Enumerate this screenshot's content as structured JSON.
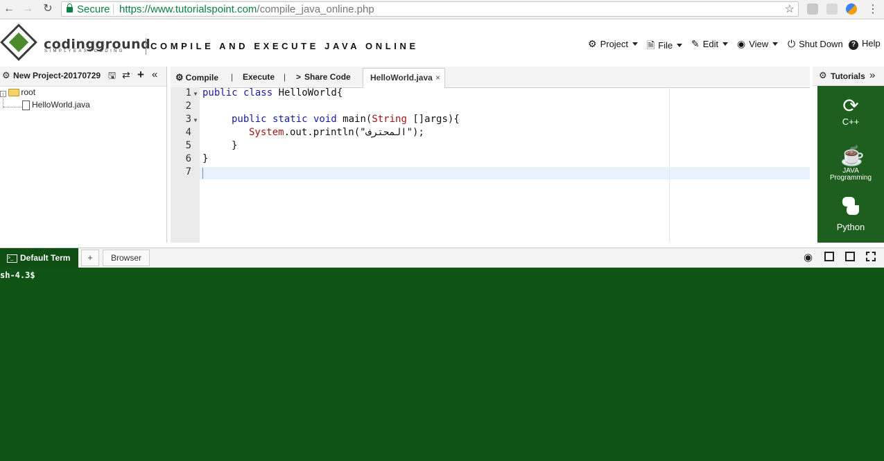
{
  "browser": {
    "secure_label": "Secure",
    "url_host": "https://www.tutorialspoint.com",
    "url_path": "/compile_java_online.php"
  },
  "header": {
    "logo_name": "codingground",
    "logo_sub": "SIMPLYEASYCODING",
    "tagline": "COMPILE AND EXECUTE JAVA ONLINE",
    "menus": [
      "Project",
      "File",
      "Edit",
      "View",
      "Shut Down",
      "Help"
    ]
  },
  "project": {
    "title": "New Project-20170729",
    "tree_root": "root",
    "tree_file": "HelloWorld.java"
  },
  "editor": {
    "compile_label": "Compile",
    "execute_label": "Execute",
    "share_label": "Share Code",
    "separator": "|",
    "file_tab": "HelloWorld.java",
    "line_numbers": [
      "1",
      "2",
      "3",
      "4",
      "5",
      "6",
      "7"
    ],
    "lines": {
      "l1_kw": "public class ",
      "l1_rest": "HelloWorld{",
      "l3_kw": "public static void ",
      "l3_rest1": "main(",
      "l3_type": "String",
      "l3_rest2": " []args){",
      "l4_type": "System",
      "l4_rest": ".out.println(\"المحترف\");",
      "l5": "}",
      "l6": "}"
    }
  },
  "right_panel": {
    "title": "Tutorials",
    "items": [
      "C++",
      "JAVA Programming",
      "Python"
    ]
  },
  "terminal": {
    "tab_label": "Default Term",
    "add_label": "+",
    "browser_label": "Browser",
    "prompt": "sh-4.3$"
  },
  "colors": {
    "terminal_bg": "#0f5414",
    "tutorial_bg": "#1e5e1e",
    "secure_green": "#0b8043",
    "keyword": "#1a1aa6",
    "type": "#a31515"
  }
}
